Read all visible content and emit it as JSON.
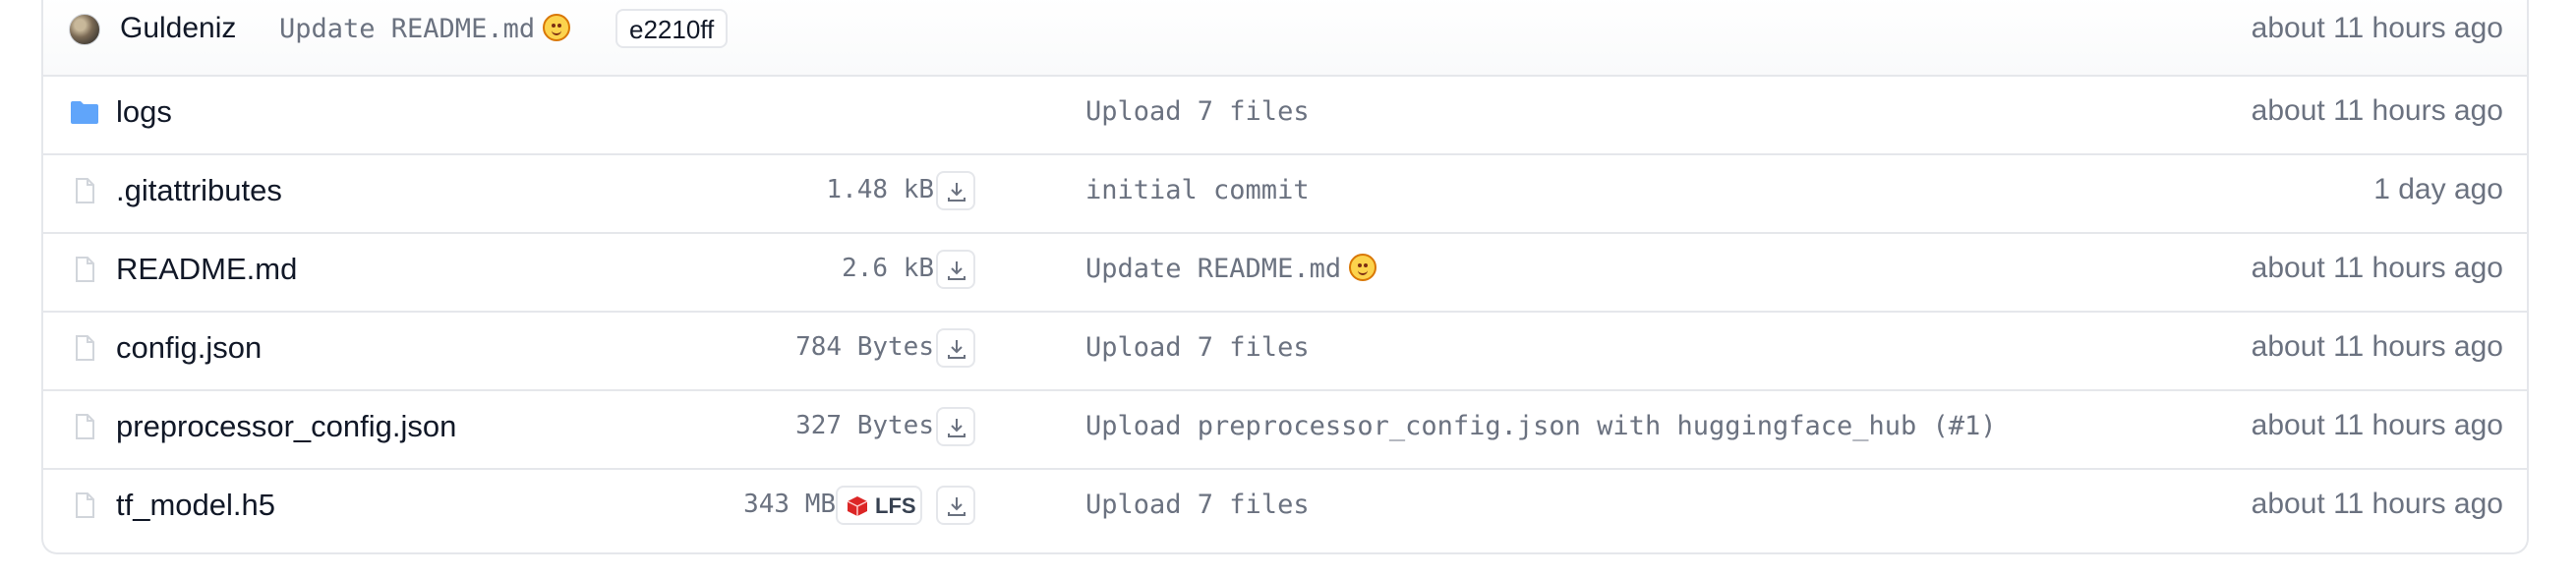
{
  "latest_commit": {
    "author": "Guldeniz",
    "message": "Update README.md",
    "message_emoji": "smiling-face-icon",
    "hash": "e2210ff",
    "time": "about 11 hours ago"
  },
  "files": [
    {
      "type": "folder",
      "name": "logs",
      "size": "",
      "lfs": false,
      "commit": "Upload 7 files",
      "time": "about 11 hours ago"
    },
    {
      "type": "file",
      "name": ".gitattributes",
      "size": "1.48 kB",
      "lfs": false,
      "commit": "initial commit",
      "time": "1 day ago"
    },
    {
      "type": "file",
      "name": "README.md",
      "size": "2.6 kB",
      "lfs": false,
      "commit": "Update README.md",
      "commit_emoji": "smiling-face-icon",
      "time": "about 11 hours ago"
    },
    {
      "type": "file",
      "name": "config.json",
      "size": "784 Bytes",
      "lfs": false,
      "commit": "Upload 7 files",
      "time": "about 11 hours ago"
    },
    {
      "type": "file",
      "name": "preprocessor_config.json",
      "size": "327 Bytes",
      "lfs": false,
      "commit": "Upload preprocessor_config.json with huggingface_hub (#1)",
      "time": "about 11 hours ago"
    },
    {
      "type": "file",
      "name": "tf_model.h5",
      "size": "343 MB",
      "lfs": true,
      "lfs_label": "LFS",
      "commit": "Upload 7 files",
      "time": "about 11 hours ago"
    }
  ],
  "colors": {
    "folder": "#60a5fa",
    "muted_text": "#6b7280",
    "border": "#e5e7eb",
    "lfs_cube": "#dc2626"
  }
}
